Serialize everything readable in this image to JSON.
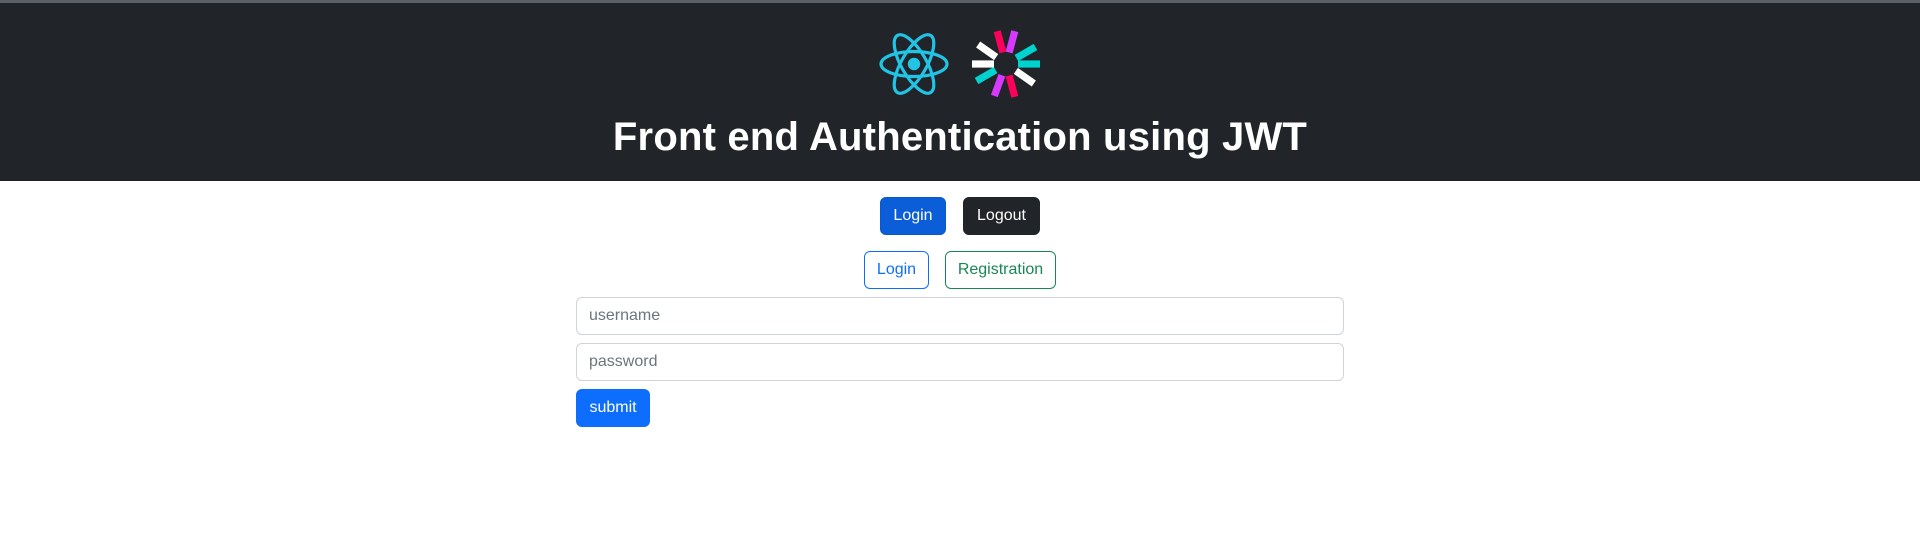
{
  "header": {
    "title": "Front end Authentication using JWT",
    "logos": [
      {
        "icon": "react-logo-icon",
        "color": "#22c4e6"
      },
      {
        "icon": "jwt-logo-icon",
        "colors": [
          "#fb015b",
          "#d63aff",
          "#00b9f1",
          "#ffffff"
        ]
      }
    ],
    "background": "#212529"
  },
  "nav": {
    "login_label": "Login",
    "logout_label": "Logout"
  },
  "tabs": {
    "login_label": "Login",
    "registration_label": "Registration"
  },
  "form": {
    "username_placeholder": "username",
    "username_value": "",
    "password_placeholder": "password",
    "password_value": "",
    "submit_label": "submit"
  },
  "colors": {
    "primary": "#0d6efd",
    "primary_active": "#0b5ed7",
    "dark": "#212529",
    "success": "#198754"
  }
}
